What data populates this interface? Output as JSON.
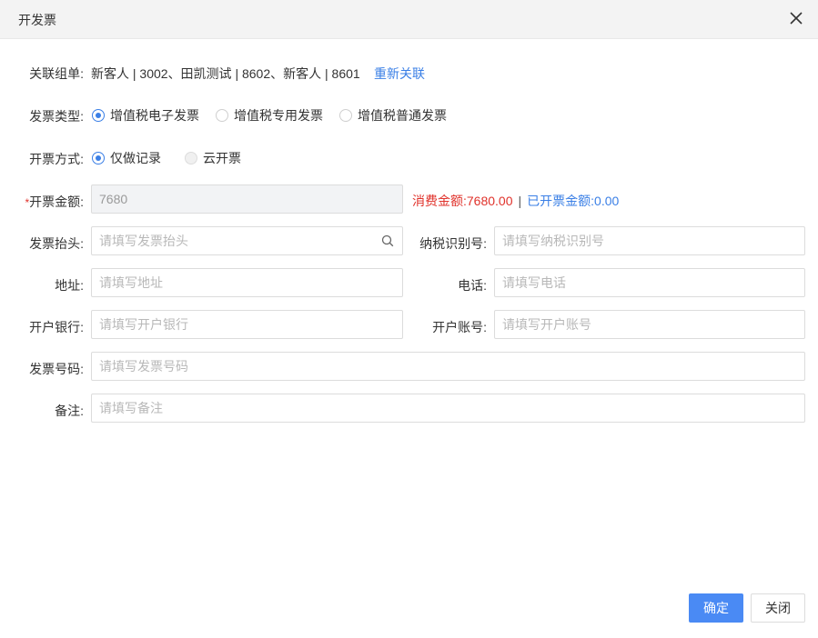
{
  "dialog": {
    "title": "开发票",
    "close_icon": "close-icon"
  },
  "linked_orders": {
    "label": "关联组单:",
    "value": "新客人 | 3002、田凯测试 | 8602、新客人 | 8601",
    "relink_label": "重新关联"
  },
  "invoice_type": {
    "label": "发票类型:",
    "options": [
      {
        "label": "增值税电子发票",
        "checked": true
      },
      {
        "label": "增值税专用发票",
        "checked": false
      },
      {
        "label": "增值税普通发票",
        "checked": false
      }
    ]
  },
  "issue_method": {
    "label": "开票方式:",
    "options": [
      {
        "label": "仅做记录",
        "checked": true
      },
      {
        "label": "云开票",
        "checked": false,
        "disabled": true
      }
    ]
  },
  "amount": {
    "required_mark": "*",
    "label": "开票金额:",
    "value": "7680",
    "consumption_label": "消费金额:",
    "consumption_value": "7680.00",
    "separator": "|",
    "issued_label": "已开票金额:",
    "issued_value": "0.00"
  },
  "fields": {
    "title": {
      "label": "发票抬头:",
      "placeholder": "请填写发票抬头"
    },
    "tax_id": {
      "label": "纳税识别号:",
      "placeholder": "请填写纳税识别号"
    },
    "address": {
      "label": "地址:",
      "placeholder": "请填写地址"
    },
    "phone": {
      "label": "电话:",
      "placeholder": "请填写电话"
    },
    "bank": {
      "label": "开户银行:",
      "placeholder": "请填写开户银行"
    },
    "account": {
      "label": "开户账号:",
      "placeholder": "请填写开户账号"
    },
    "invoice_no": {
      "label": "发票号码:",
      "placeholder": "请填写发票号码"
    },
    "remark": {
      "label": "备注:",
      "placeholder": "请填写备注"
    }
  },
  "buttons": {
    "confirm": "确定",
    "close": "关闭"
  },
  "colors": {
    "primary": "#4a8af4",
    "link": "#3a7fe6",
    "danger": "#e0322b",
    "header_bg": "#f3f3f3"
  }
}
